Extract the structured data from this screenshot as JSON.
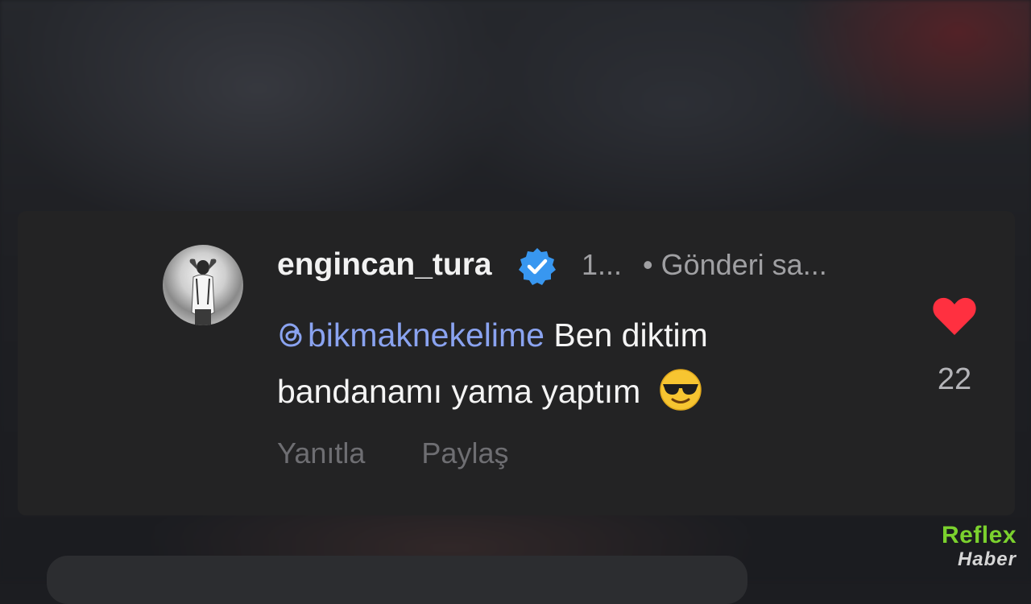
{
  "comment": {
    "username": "engincan_tura",
    "time": "1...",
    "post_meta": "• Gönderi sa...",
    "mention": "bikmaknekelime",
    "text_line1_rest": " Ben diktim",
    "text_line2": "bandanamı yama yaptım",
    "emoji": "smiling-face-with-sunglasses",
    "actions": {
      "reply": "Yanıtla",
      "share": "Paylaş"
    },
    "likes": "22"
  },
  "icons": {
    "avatar": "profile-photo",
    "verified": "verified-badge-icon",
    "mention_prefix": "threads-icon",
    "like": "heart-icon"
  },
  "colors": {
    "card_bg": "#232324",
    "mention": "#8aa3f0",
    "verified": "#3897f0",
    "heart": "#ff3040",
    "watermark_brand": "#7bd12e"
  },
  "watermark": {
    "brand": "Reflex",
    "sub": "Haber"
  }
}
